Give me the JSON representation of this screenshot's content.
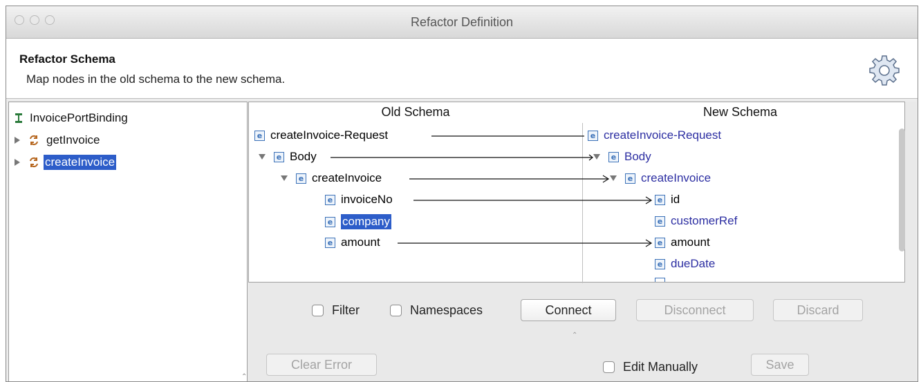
{
  "window": {
    "title": "Refactor Definition"
  },
  "header": {
    "title": "Refactor Schema",
    "subtitle": "Map nodes in the old schema to the new schema."
  },
  "tree": {
    "root": "InvoicePortBinding",
    "items": [
      {
        "label": "getInvoice"
      },
      {
        "label": "createInvoice"
      }
    ]
  },
  "schema": {
    "old_header": "Old Schema",
    "new_header": "New Schema",
    "old_nodes": [
      "createInvoice-Request",
      "Body",
      "createInvoice",
      "invoiceNo",
      "company",
      "amount"
    ],
    "new_nodes": [
      "createInvoice-Request",
      "Body",
      "createInvoice",
      "id",
      "customerRef",
      "amount",
      "dueDate"
    ]
  },
  "controls": {
    "filter": "Filter",
    "namespaces": "Namespaces",
    "connect": "Connect",
    "disconnect": "Disconnect",
    "discard": "Discard",
    "clear_error": "Clear Error",
    "edit_manually": "Edit Manually",
    "save": "Save"
  },
  "colors": {
    "selection": "#2d5dc9",
    "unmapped_text": "#2c2ea2",
    "element_icon": "#3b71b8"
  }
}
